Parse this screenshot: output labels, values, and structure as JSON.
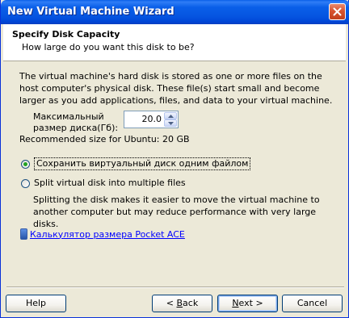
{
  "window": {
    "title": "New Virtual Machine Wizard"
  },
  "header": {
    "title": "Specify Disk Capacity",
    "subtitle": "How large do you want this disk to be?"
  },
  "body": {
    "description": "The virtual machine's hard disk is stored as one or more files on the host computer's physical disk. These file(s) start small and become larger as you add applications, files, and data to your virtual machine.",
    "max_size_label": "Максимальный размер диска(Гб):",
    "max_size_value": "20.0",
    "recommended": "Recommended size for Ubuntu: 20 GB",
    "option_single": "Сохранить виртуальный диск одним файлом",
    "option_single_selected": true,
    "option_split": "Split virtual disk into multiple files",
    "option_split_selected": false,
    "split_description": "Splitting the disk makes it easier to move the virtual machine to another computer but may reduce performance with very large disks.",
    "calculator_link": "Калькулятор размера Pocket ACE"
  },
  "buttons": {
    "help": "Help",
    "back_prefix": "< ",
    "back_key": "B",
    "back_rest": "ack",
    "next_key": "N",
    "next_rest": "ext >",
    "cancel": "Cancel"
  },
  "colors": {
    "titlebar": "#0a5fe8",
    "dialog_bg": "#ece9d8",
    "link": "#0000ff"
  }
}
